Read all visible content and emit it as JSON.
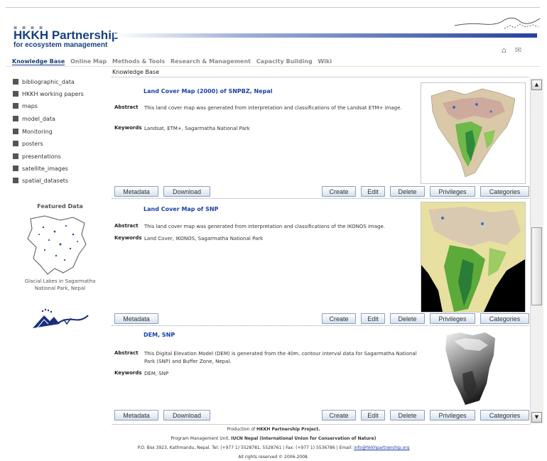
{
  "header": {
    "dots": "▪ ▪ ▪ ▪",
    "title": "HKKH Partnership",
    "subtitle": "for ecosystem management",
    "home_icon": "home-icon",
    "mail_icon": "mail-icon"
  },
  "nav": {
    "items": [
      "Knowledge Base",
      "Online Map",
      "Methods & Tools",
      "Research & Management",
      "Capacity Building",
      "Wiki"
    ]
  },
  "breadcrumb": "Knowledge Base",
  "sidebar": {
    "items": [
      "bibliographic_data",
      "HKKH working papers",
      "maps",
      "model_data",
      "Monitoring",
      "posters",
      "presentations",
      "satellite_images",
      "spatial_datasets"
    ],
    "featured_heading": "Featured Data",
    "featured_caption": "Glacial Lakes in Sagarmatha National Park, Nepal"
  },
  "labels": {
    "abstract": "Abstract",
    "keywords": "Keywords"
  },
  "buttons": {
    "metadata": "Metadata",
    "download": "Download",
    "create": "Create",
    "edit": "Edit",
    "delete": "Delete",
    "privileges": "Privileges",
    "categories": "Categories"
  },
  "records": [
    {
      "title": "Land Cover Map (2000) of SNPBZ, Nepal",
      "abstract": "This land cover map was generated from interpretation and classifications of the Landsat ETM+ image.",
      "keywords": "Landsat, ETM+, Sagarmatha National Park"
    },
    {
      "title": "Land Cover Map of SNP",
      "abstract": "This land cover map was generated from interpretation and classifications of the IKONOS image.",
      "keywords": "Land Cover, IKONOS, Sagarmatha National Park"
    },
    {
      "title": "DEM, SNP",
      "abstract": "This Digital Elevation Model (DEM) is generated from the 40m. contour interval data for Sagarmatha National Park (SNP) and Buffer Zone, Nepal.",
      "keywords": "DEM, SNP"
    }
  ],
  "footer": {
    "line1_pre": "Production of ",
    "line1_bold": "HKKH Partnership Project.",
    "line2_pre": "Program Management Unit, ",
    "line2_bold": "IUCN Nepal (International Union for Conservation of Nature)",
    "line3": "P.O. Box 3923, Kathmandu, Nepal. Tel: (+977 1) 5528781, 5528761 | Fax: (+977 1) 5536786 | Email: ",
    "email": "info@hkkhpartnership.org",
    "line4": "All rights reserved © 2006-2008."
  },
  "colors": {
    "brand": "#17407e",
    "link": "#1a3fa8",
    "separator": "#8ea2c4"
  }
}
